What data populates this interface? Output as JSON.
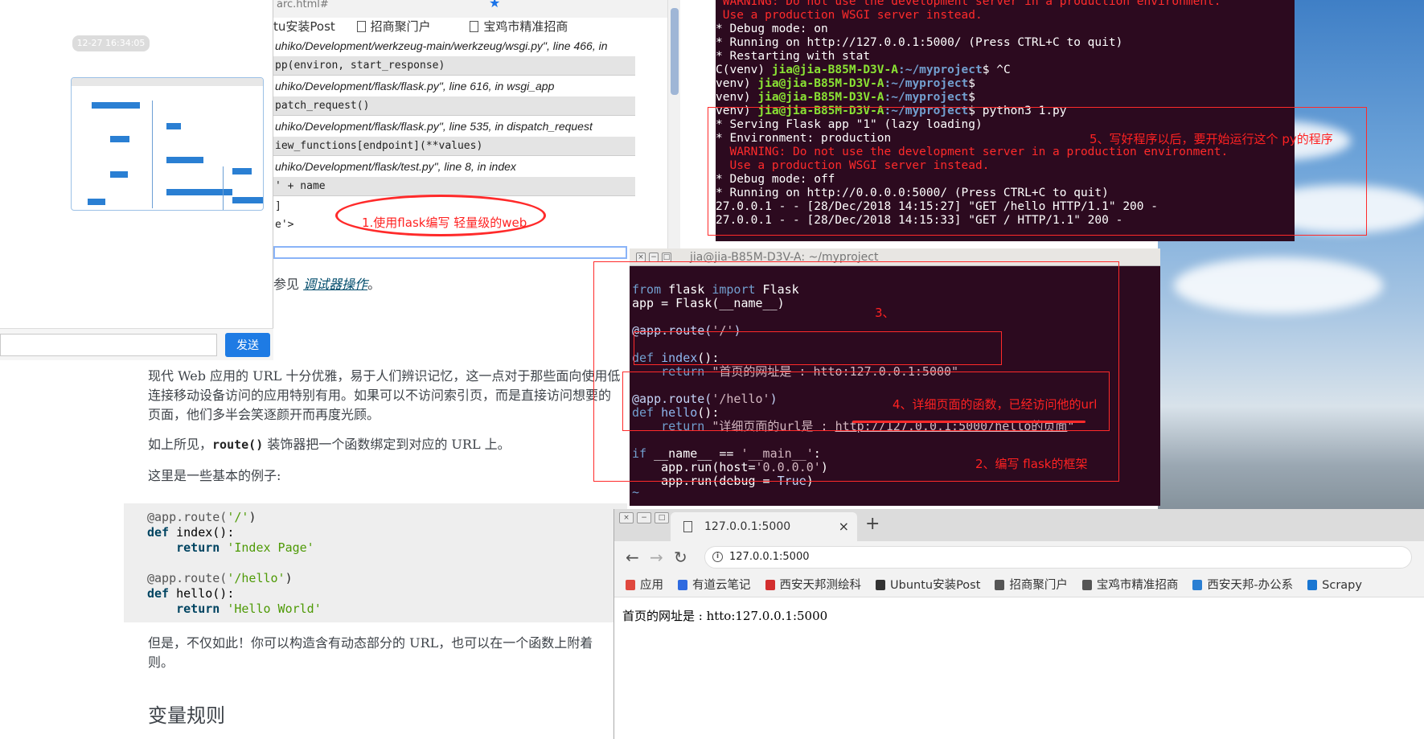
{
  "docs": {
    "debugger_ref_prefix": "参见 ",
    "debugger_ref_link": "调试器操作",
    "debugger_ref_suffix": "。",
    "para1_line1": "现代 Web 应用的 URL 十分优雅，易于人们辨识记忆，这一点对于那些面向使用低",
    "para1_line2": "连接移动设备访问的应用特别有用。如果可以不访问索引页，而是直接访问想要的",
    "para1_line3": "页面，他们多半会笑逐颜开而再度光顾。",
    "para2_prefix": "如上所见，",
    "para2_code": "route()",
    "para2_suffix": " 装饰器把一个函数绑定到对应的 URL 上。",
    "para3": "这里是一些基本的例子:",
    "code": {
      "l1_dec": "@app.route(",
      "l1_str": "'/'",
      "l1_end": ")",
      "l2_kw": "def",
      "l2_fn": " index():",
      "l3_kw": "    return",
      "l3_str": " 'Index Page'",
      "l5_dec": "@app.route(",
      "l5_str": "'/hello'",
      "l5_end": ")",
      "l6_kw": "def",
      "l6_fn": " hello():",
      "l7_kw": "    return",
      "l7_str": " 'Hello World'"
    },
    "para4_line1": "但是，不仅如此！你可以构造含有动态部分的 URL，也可以在一个函数上附着",
    "para4_line2": "则。",
    "heading": "变量规则"
  },
  "traceback": {
    "tab_partial": "arc.html#",
    "bookmarks": [
      "tu安装Post",
      "招商聚门户",
      "宝鸡市精准招商"
    ],
    "more": "»",
    "lines": [
      {
        "kind": "file",
        "text": "uhiko/Development/werkzeug-main/werkzeug/wsgi.py\", line 466, in"
      },
      {
        "kind": "code",
        "text": "pp(environ, start_response)"
      },
      {
        "kind": "file",
        "text": "uhiko/Development/flask/flask.py\", line 616, in wsgi_app"
      },
      {
        "kind": "code",
        "text": "patch_request()"
      },
      {
        "kind": "file",
        "text": "uhiko/Development/flask/flask.py\", line 535, in dispatch_request"
      },
      {
        "kind": "code",
        "text": "iew_functions[endpoint](**values)"
      },
      {
        "kind": "file",
        "text": "uhiko/Development/flask/test.py\", line 8, in index"
      },
      {
        "kind": "code",
        "text": " ' + name"
      }
    ],
    "tail1": "]",
    "tail2": "e'>"
  },
  "chat": {
    "timestamp": "12-27 16:34:05",
    "input_value": "",
    "send_label": "发送"
  },
  "terminal_top": {
    "lines": [
      {
        "c": "warn",
        "t": " WARNING: Do not use the development server in a production environment."
      },
      {
        "c": "warn",
        "t": " Use a production WSGI server instead."
      },
      {
        "c": "",
        "t": "* Debug mode: on"
      },
      {
        "c": "",
        "t": "* Running on http://127.0.0.1:5000/ (Press CTRL+C to quit)"
      },
      {
        "c": "",
        "t": "* Restarting with stat"
      },
      {
        "c": "p",
        "pre": "C(venv) ",
        "user": "jia@jia-B85M-D3V-A",
        "path": ":~/myproject",
        "post": "$ ^C"
      },
      {
        "c": "p",
        "pre": "venv) ",
        "user": "jia@jia-B85M-D3V-A",
        "path": ":~/myproject",
        "post": "$"
      },
      {
        "c": "p",
        "pre": "venv) ",
        "user": "jia@jia-B85M-D3V-A",
        "path": ":~/myproject",
        "post": "$"
      },
      {
        "c": "p",
        "pre": "venv) ",
        "user": "jia@jia-B85M-D3V-A",
        "path": ":~/myproject",
        "post": "$ python3 1.py"
      },
      {
        "c": "",
        "t": "* Serving Flask app \"1\" (lazy loading)"
      },
      {
        "c": "",
        "t": "* Environment: production"
      },
      {
        "c": "warn",
        "t": "  WARNING: Do not use the development server in a production environment."
      },
      {
        "c": "warn2",
        "t": "  Use a production WSGI server instead."
      },
      {
        "c": "",
        "t": "* Debug mode: off"
      },
      {
        "c": "",
        "t": "* Running on http://0.0.0.0:5000/ (Press CTRL+C to quit)"
      },
      {
        "c": "",
        "t": "27.0.0.1 - - [28/Dec/2018 14:15:27] \"GET /hello HTTP/1.1\" 200 -"
      },
      {
        "c": "",
        "t": "27.0.0.1 - - [28/Dec/2018 14:15:33] \"GET / HTTP/1.1\" 200 -"
      }
    ]
  },
  "editor": {
    "title": "jia@jia-B85M-D3V-A: ~/myproject",
    "tilde": "~",
    "code": {
      "l1a": "from",
      "l1b": " flask ",
      "l1c": "import",
      "l1d": " Flask",
      "l2": "app = Flask(__name__)",
      "l4a": "@app.route(",
      "l4b": "'/'",
      "l4c": ")",
      "l6a": "def",
      "l6b": " index",
      "l6c": "():",
      "l7a": "    return",
      "l7b": " \"首页的网址是 : htto:127.0.0.1:5000\"",
      "l9a": "@app.route(",
      "l9b": "'/hello'",
      "l9c": ")",
      "l10a": "def",
      "l10b": " hello",
      "l10c": "():",
      "l11a": "    return",
      "l11b": " \"详细页面的url是 : ",
      "l11c": "http://127.0.0.1:5000/hello的页面",
      "l11d": "\"",
      "l13a": "if",
      "l13b": " __name__ == ",
      "l13c": "'__main__'",
      "l13d": ":",
      "l14a": "    app.run(host=",
      "l14b": "'0.0.0.0'",
      "l14c": ")",
      "l15a": "    app.run(debug = ",
      "l15b": "True",
      "l15c": ")"
    }
  },
  "browser": {
    "tab_title": "127.0.0.1:5000",
    "tab_close": "×",
    "new_tab": "+",
    "url": "127.0.0.1:5000",
    "bookmarks": [
      {
        "label": "应用",
        "color": "#e0483e",
        "icon": "apps-icon"
      },
      {
        "label": "有道云笔记",
        "color": "#2f6be0",
        "icon": "note-icon"
      },
      {
        "label": "西安天邦测绘科",
        "color": "#d32f2f",
        "icon": "survey-icon"
      },
      {
        "label": "Ubuntu安装Post",
        "color": "#333333",
        "icon": "link-icon"
      },
      {
        "label": "招商聚门户",
        "color": "#555555",
        "icon": "page-icon"
      },
      {
        "label": "宝鸡市精准招商",
        "color": "#555555",
        "icon": "page-icon"
      },
      {
        "label": "西安天邦-办公系",
        "color": "#2a7fd3",
        "icon": "globe-icon"
      },
      {
        "label": "Scrapy",
        "color": "#1976d2",
        "icon": "scrapy-icon"
      }
    ],
    "content": "首页的网址是 : htto:127.0.0.1:5000"
  },
  "annotations": {
    "a1": "1.使用flask编写 轻量级的web",
    "a2": "2、编写 flask的框架",
    "a3": "3、",
    "a4": "4、详细页面的函数，已经访问他的url",
    "a5": "5、写好程序以后，要开始运行这个 py的程序"
  }
}
